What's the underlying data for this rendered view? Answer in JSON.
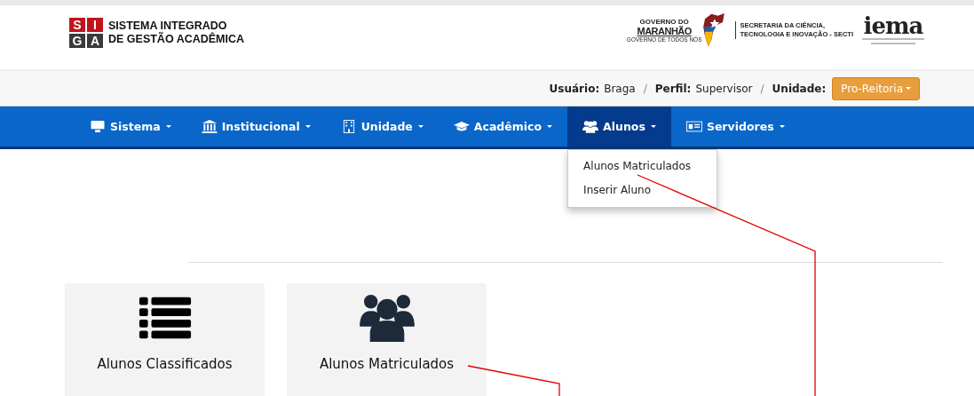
{
  "header": {
    "siga_letters": [
      "S",
      "I",
      "G",
      "A"
    ],
    "system_name": [
      "SISTEMA INTEGRADO",
      "DE GESTÃO ACADÊMICA"
    ],
    "gov_logo": {
      "top": "GOVERNO DO",
      "main": "MARANHÃO",
      "slogan": "GOVERNO DE TODOS NÓS"
    },
    "secretaria": [
      "SECRETARIA DA CIÊNCIA,",
      "TECNOLOGIA E INOVAÇÃO - SECTI"
    ],
    "iema_logo": "iema"
  },
  "user_bar": {
    "fields": [
      {
        "label": "Usuário:",
        "value": "Braga"
      },
      {
        "label": "Perfil:",
        "value": "Supervisor"
      }
    ],
    "separator": "/",
    "unit_label": "Unidade:",
    "unit_button": "Pro-Reitoria"
  },
  "nav": [
    {
      "label": "Sistema",
      "kind": "monitor",
      "selected": false
    },
    {
      "label": "Institucional",
      "kind": "bank",
      "selected": false
    },
    {
      "label": "Unidade",
      "kind": "building",
      "selected": false
    },
    {
      "label": "Acadêmico",
      "kind": "cap",
      "selected": false
    },
    {
      "label": "Alunos",
      "kind": "users",
      "selected": true,
      "menu": [
        "Alunos Matriculados",
        "Inserir Aluno"
      ]
    },
    {
      "label": "Servidores",
      "kind": "card",
      "selected": false
    }
  ],
  "cards": [
    {
      "label": "Alunos Classificados",
      "kind": "list"
    },
    {
      "label": "Alunos Matriculados",
      "kind": "users"
    }
  ]
}
